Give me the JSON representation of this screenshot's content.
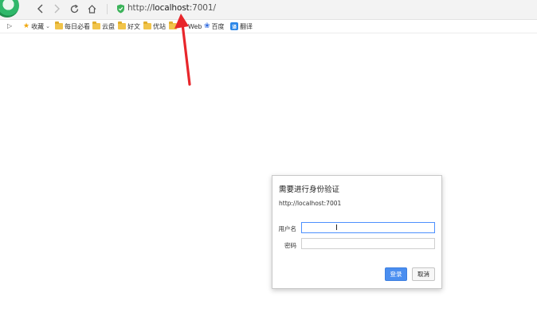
{
  "browser": {
    "url_prefix": "http://",
    "url_host": "localhost",
    "url_suffix": ":7001/"
  },
  "bookmarks": [
    {
      "label": "收藏",
      "icon": "star-icon",
      "has_dropdown": true
    },
    {
      "label": "每日必看",
      "icon": "folder-icon"
    },
    {
      "label": "云盘",
      "icon": "folder-icon"
    },
    {
      "label": "好文",
      "icon": "folder-icon"
    },
    {
      "label": "优站",
      "icon": "folder-icon"
    },
    {
      "label": "Web",
      "icon": "folder-icon"
    },
    {
      "label": "百度",
      "icon": "baidu-icon"
    },
    {
      "label": "翻译",
      "icon": "fanyi-icon"
    }
  ],
  "auth_dialog": {
    "title": "需要进行身份验证",
    "host": "http://localhost:7001",
    "username_label": "用户名",
    "username_value": "",
    "password_label": "密码",
    "password_value": "",
    "login_label": "登录",
    "cancel_label": "取消"
  },
  "colors": {
    "annotation_arrow": "#e8262b",
    "primary_button": "#4a8ef0",
    "focus_border": "#4d90fe"
  }
}
